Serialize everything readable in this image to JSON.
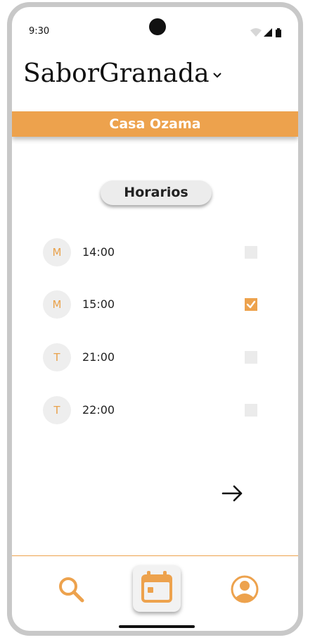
{
  "status": {
    "time": "9:30"
  },
  "app": {
    "brand": "SaborGranada",
    "restaurant": "Casa Ozama"
  },
  "section": {
    "title": "Horarios"
  },
  "slots": [
    {
      "badge": "M",
      "time": "14:00",
      "checked": false
    },
    {
      "badge": "M",
      "time": "15:00",
      "checked": true
    },
    {
      "badge": "T",
      "time": "21:00",
      "checked": false
    },
    {
      "badge": "T",
      "time": "22:00",
      "checked": false
    }
  ],
  "colors": {
    "accent": "#eda24d",
    "badge_bg": "#eeeeee",
    "frame": "#c8c8c8"
  },
  "icons": {
    "brand_dropdown": "chevron-down-icon",
    "next": "arrow-right-icon",
    "nav": [
      "search-icon",
      "calendar-icon",
      "profile-icon"
    ]
  }
}
